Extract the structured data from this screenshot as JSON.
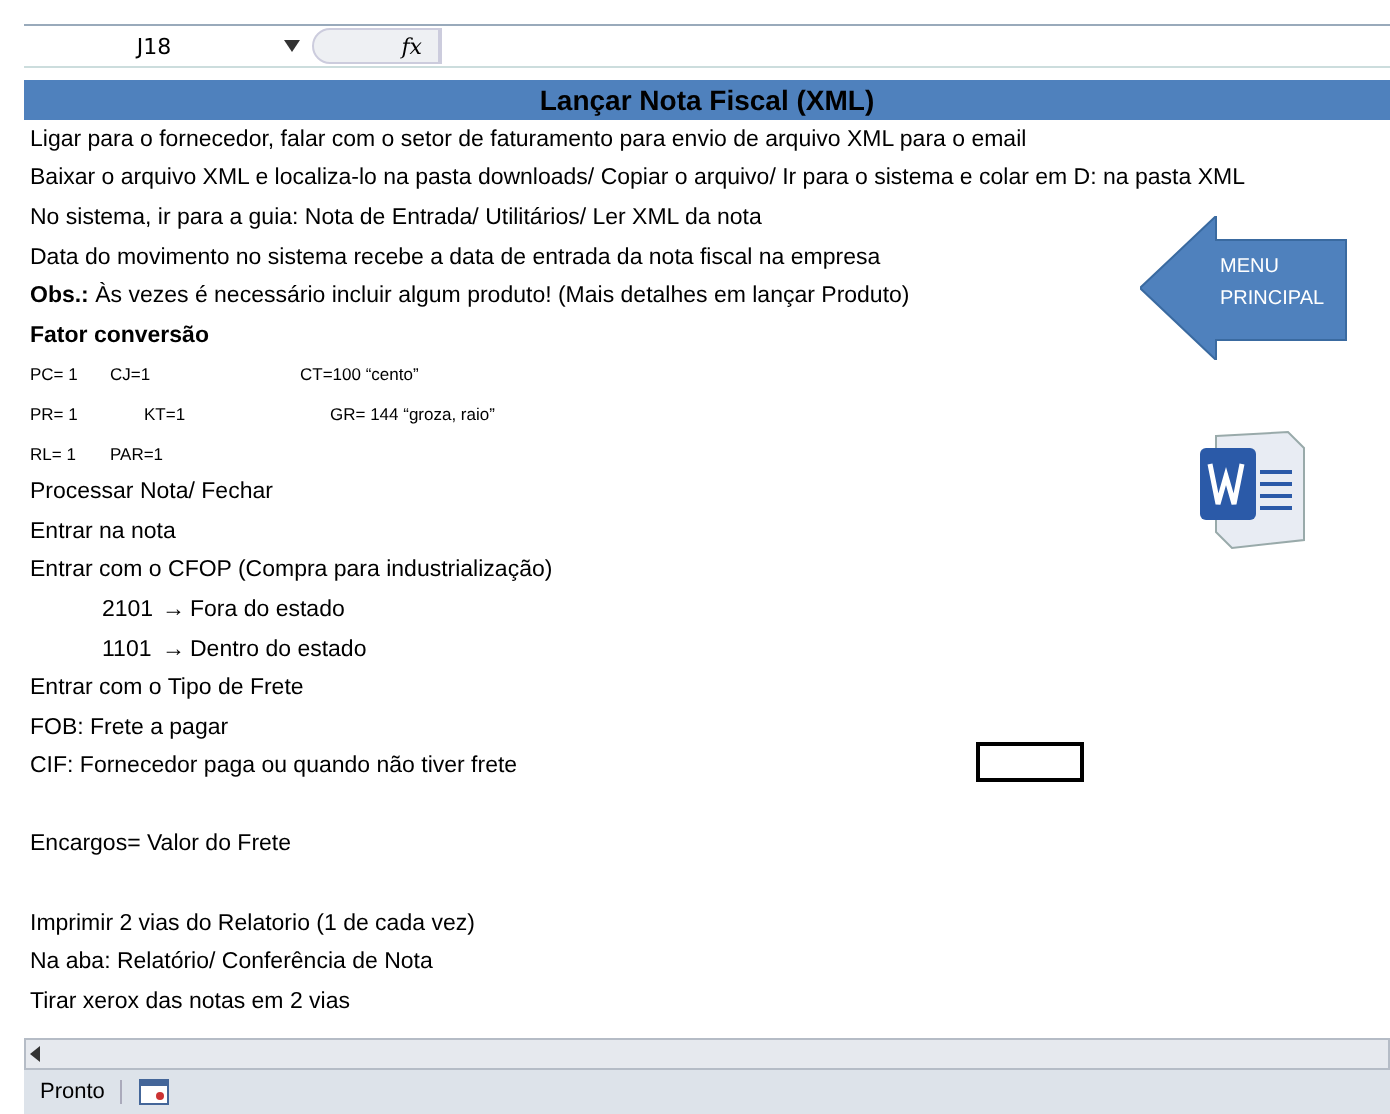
{
  "formula_bar": {
    "cell_ref": "J18",
    "fx": "fx"
  },
  "title": "Lançar Nota Fiscal (XML)",
  "rows": [
    {
      "kind": "text",
      "text": "Ligar para o fornecedor, falar com o setor de faturamento para envio de arquivo XML para o email"
    },
    {
      "kind": "text",
      "text": "Baixar o arquivo XML e localiza-lo na pasta downloads/ Copiar o arquivo/ Ir para o sistema e colar em D: na pasta XML"
    },
    {
      "kind": "text",
      "text": "No sistema, ir para a guia: Nota de Entrada/ Utilitários/ Ler XML da nota"
    },
    {
      "kind": "text",
      "text": "Data do movimento no sistema recebe a data de entrada da nota fiscal na empresa"
    },
    {
      "kind": "text",
      "text": "**Obs.:** Às vezes é necessário incluir algum produto! (Mais detalhes em lançar Produto)"
    },
    {
      "kind": "bold",
      "text": "Fator conversão"
    },
    {
      "kind": "small",
      "cells": [
        "PC= 1",
        "CJ=1",
        "CT=100   “cento”"
      ]
    },
    {
      "kind": "small",
      "cells": [
        "PR= 1",
        "KT=1",
        "GR= 144   “groza, raio”"
      ]
    },
    {
      "kind": "small",
      "cells": [
        "RL= 1",
        "PAR=1"
      ]
    },
    {
      "kind": "text",
      "text": "Processar Nota/ Fechar"
    },
    {
      "kind": "text",
      "text": "Entrar na nota"
    },
    {
      "kind": "text",
      "text": "Entrar com o CFOP (Compra para industrialização)"
    },
    {
      "kind": "indent",
      "code": "2101",
      "arrow": "→",
      "text": "Fora do estado"
    },
    {
      "kind": "indent",
      "code": "1101",
      "arrow": "→",
      "text": "Dentro do estado"
    },
    {
      "kind": "text",
      "text": "Entrar com o Tipo de Frete"
    },
    {
      "kind": "text",
      "text": "FOB: Frete a pagar"
    },
    {
      "kind": "text",
      "text": "CIF: Fornecedor paga  ou quando não tiver frete"
    },
    {
      "kind": "blank"
    },
    {
      "kind": "text",
      "text": "Encargos= Valor do Frete"
    },
    {
      "kind": "blank"
    },
    {
      "kind": "text",
      "text": "Imprimir 2 vias do Relatorio (1 de cada vez)"
    },
    {
      "kind": "text",
      "text": "Na aba: Relatório/ Conferência de Nota"
    },
    {
      "kind": "text",
      "text": "Tirar xerox das notas em 2 vias"
    }
  ],
  "menu_button": {
    "line1": "MENU",
    "line2": "PRINCIPAL"
  },
  "status_bar": {
    "status": "Pronto"
  }
}
